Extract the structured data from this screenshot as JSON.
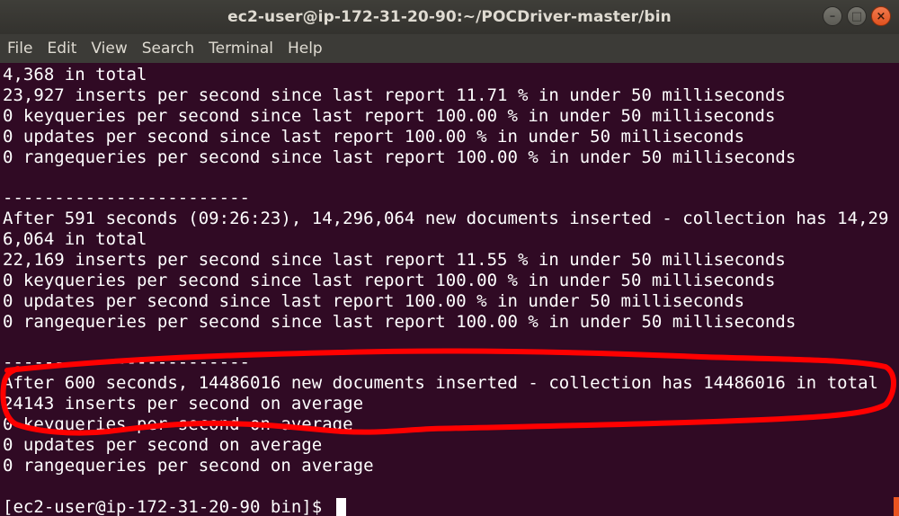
{
  "window": {
    "title": "ec2-user@ip-172-31-20-90:~/POCDriver-master/bin",
    "buttons": [
      "–",
      "□",
      "×"
    ]
  },
  "menu": [
    "File",
    "Edit",
    "View",
    "Search",
    "Terminal",
    "Help"
  ],
  "terminal": {
    "lines": [
      "4,368 in total",
      "23,927 inserts per second since last report 11.71 % in under 50 milliseconds",
      "0 keyqueries per second since last report 100.00 % in under 50 milliseconds",
      "0 updates per second since last report 100.00 % in under 50 milliseconds",
      "0 rangequeries per second since last report 100.00 % in under 50 milliseconds",
      "",
      "------------------------",
      "After 591 seconds (09:26:23), 14,296,064 new documents inserted - collection has 14,29",
      "6,064 in total",
      "22,169 inserts per second since last report 11.55 % in under 50 milliseconds",
      "0 keyqueries per second since last report 100.00 % in under 50 milliseconds",
      "0 updates per second since last report 100.00 % in under 50 milliseconds",
      "0 rangequeries per second since last report 100.00 % in under 50 milliseconds",
      "",
      "------------------------",
      "After 600 seconds, 14486016 new documents inserted - collection has 14486016 in total",
      "24143 inserts per second on average",
      "0 keyqueries per second on average",
      "0 updates per second on average",
      "0 rangequeries per second on average",
      ""
    ],
    "prompt": "[ec2-user@ip-172-31-20-90 bin]$ ",
    "annotation_color": "#ff0000",
    "background": "#300a24"
  }
}
